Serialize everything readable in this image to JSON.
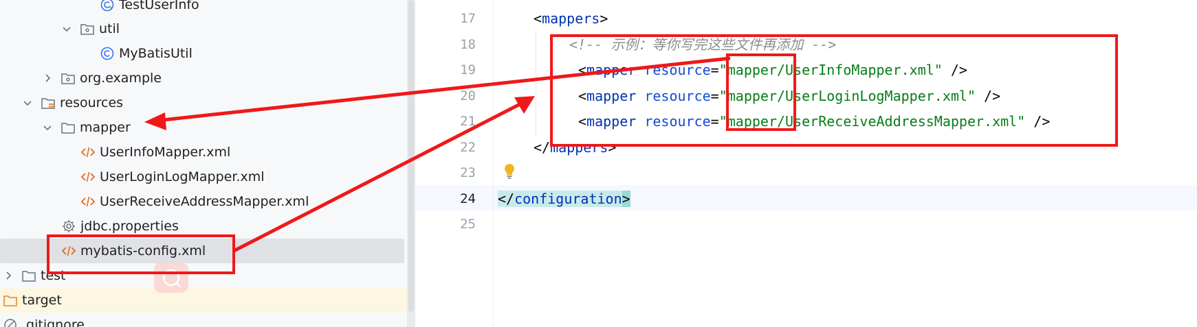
{
  "tree": {
    "items": [
      {
        "label": "TestUserInfo",
        "icon": "class-icon"
      },
      {
        "label": "util",
        "icon": "package-icon",
        "expanded": true
      },
      {
        "label": "MyBatisUtil",
        "icon": "class-icon"
      },
      {
        "label": "org.example",
        "icon": "package-icon",
        "expanded": false
      },
      {
        "label": "resources",
        "icon": "resources-folder-icon",
        "expanded": true
      },
      {
        "label": "mapper",
        "icon": "folder-icon",
        "expanded": true
      },
      {
        "label": "UserInfoMapper.xml",
        "icon": "xml-icon"
      },
      {
        "label": "UserLoginLogMapper.xml",
        "icon": "xml-icon"
      },
      {
        "label": "UserReceiveAddressMapper.xml",
        "icon": "xml-icon"
      },
      {
        "label": "jdbc.properties",
        "icon": "gear-icon"
      },
      {
        "label": "mybatis-config.xml",
        "icon": "xml-icon",
        "selected": true
      },
      {
        "label": "test",
        "icon": "folder-icon",
        "expanded": false
      },
      {
        "label": "target",
        "icon": "folder-icon-orange"
      },
      {
        "label": ".gitignore",
        "icon": "gitignore-icon"
      }
    ]
  },
  "editor": {
    "line_numbers": [
      "17",
      "18",
      "19",
      "20",
      "21",
      "22",
      "23",
      "24",
      "25"
    ],
    "current_line": "24",
    "lines": {
      "l17_open": "<",
      "l17_tag": "mappers",
      "l17_close": ">",
      "l18_comment": "<!-- 示例：等你写完这些文件再添加 -->",
      "l19_pre": "<",
      "l19_tag": "mapper",
      "l19_attr": "resource",
      "l19_eq": "=",
      "l19_str": "\"mapper/UserInfoMapper.xml\"",
      "l19_end": " />",
      "l20_pre": "<",
      "l20_tag": "mapper",
      "l20_attr": "resource",
      "l20_eq": "=",
      "l20_str": "\"mapper/UserLoginLogMapper.xml\"",
      "l20_end": " />",
      "l21_pre": "<",
      "l21_tag": "mapper",
      "l21_attr": "resource",
      "l21_eq": "=",
      "l21_str": "\"mapper/UserReceiveAddressMapper.xml\"",
      "l21_end": " />",
      "l22_open": "</",
      "l22_tag": "mappers",
      "l22_close": ">",
      "l24_open": "</",
      "l24_tag": "configuration",
      "l24_close": ">"
    }
  },
  "colors": {
    "annotation": "#f0181a",
    "tag": "#0033b3",
    "string": "#067d17",
    "comment": "#8c8c8c"
  }
}
